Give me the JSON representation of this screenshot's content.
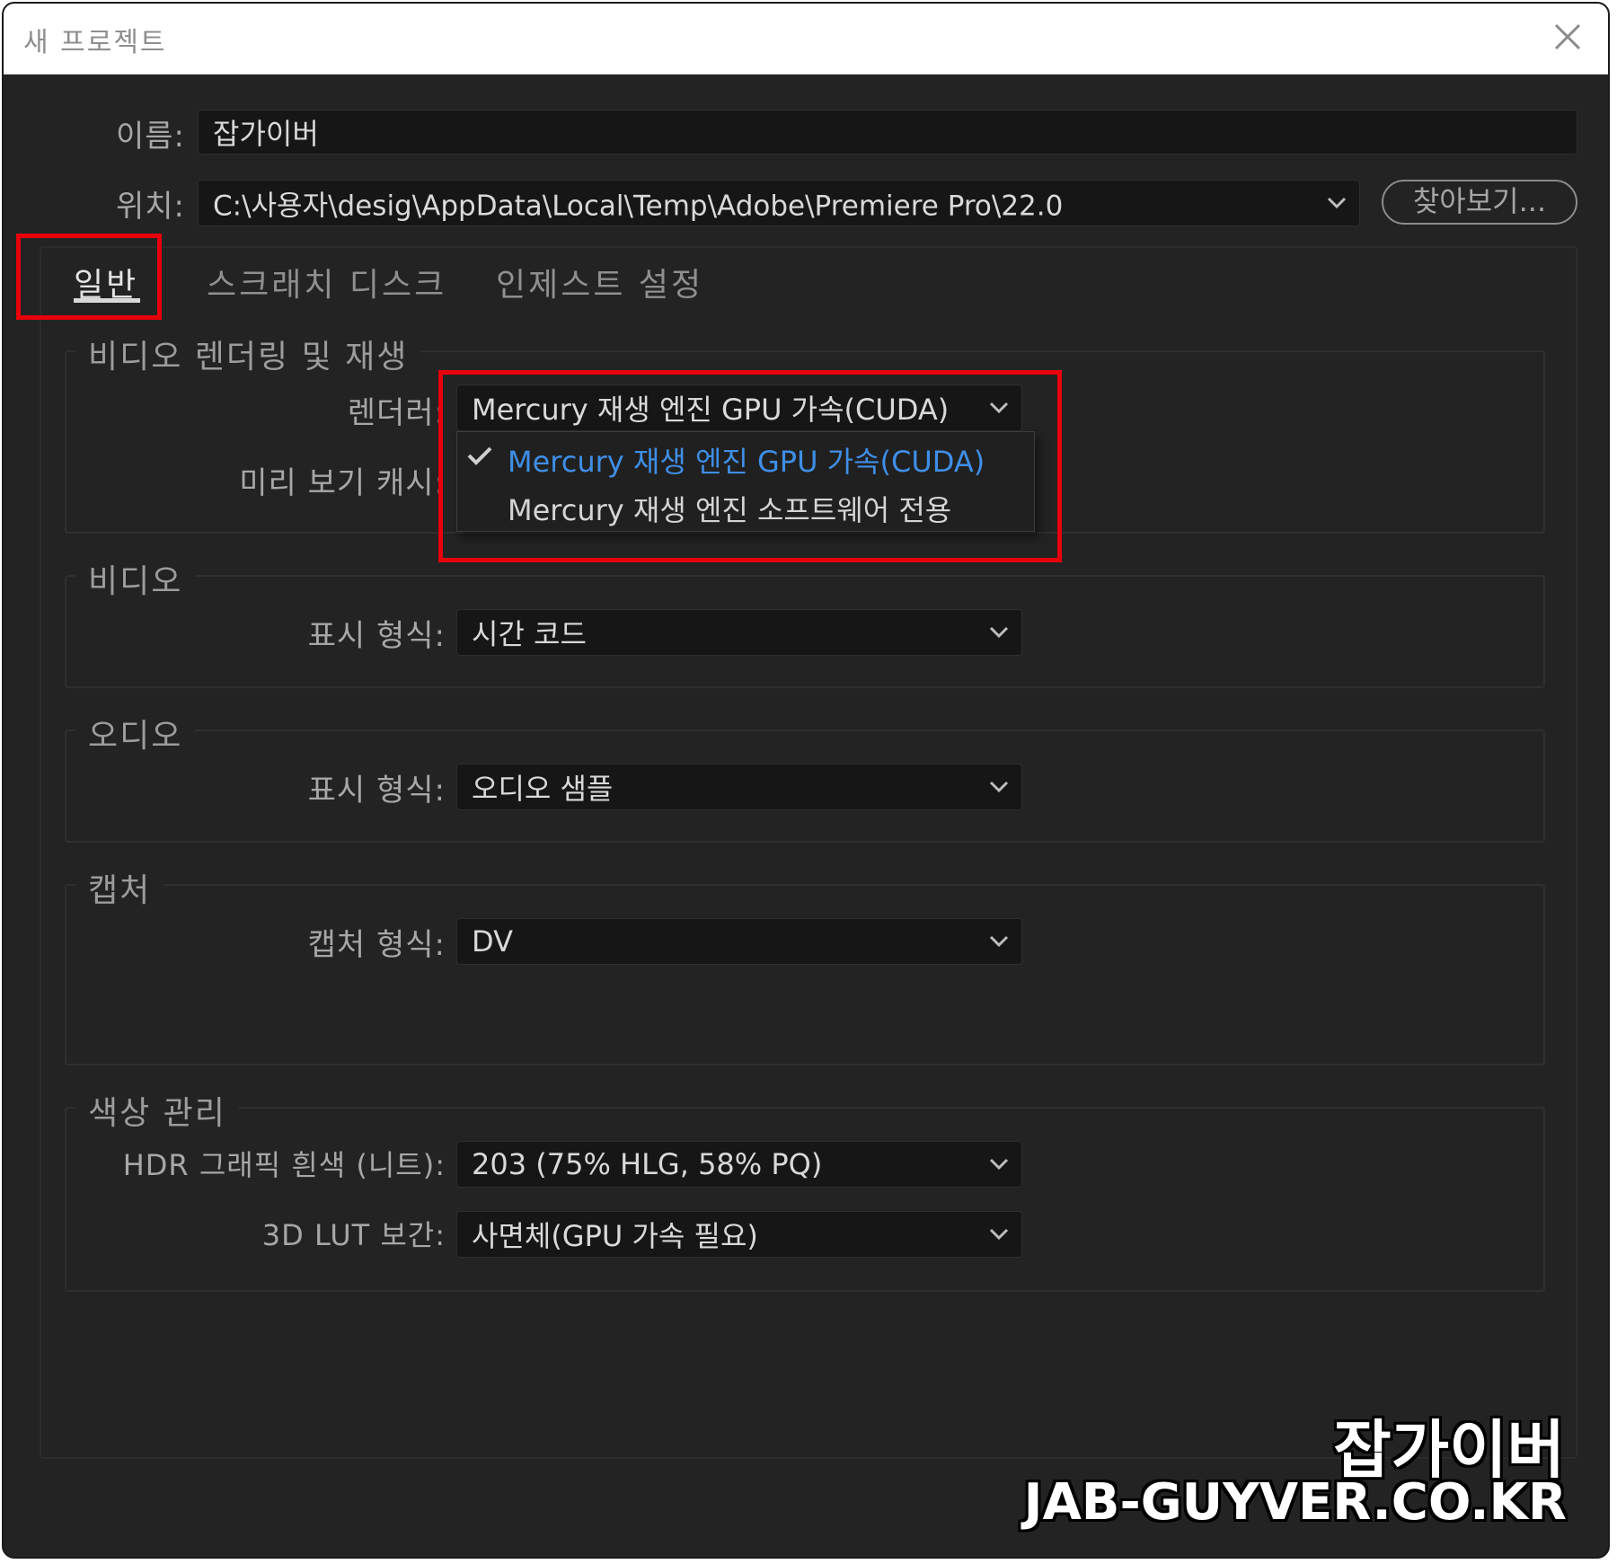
{
  "window": {
    "title": "새 프로젝트"
  },
  "form": {
    "name_label": "이름:",
    "name_value": "잡가이버",
    "location_label": "위치:",
    "location_value": "C:\\사용자\\desig\\AppData\\Local\\Temp\\Adobe\\Premiere Pro\\22.0",
    "browse_label": "찾아보기..."
  },
  "tabs": [
    {
      "label": "일반",
      "active": true
    },
    {
      "label": "스크래치 디스크",
      "active": false
    },
    {
      "label": "인제스트 설정",
      "active": false
    }
  ],
  "groups": {
    "render": {
      "title": "비디오 렌더링 및 재생",
      "renderer_label": "렌더러:",
      "renderer_value": "Mercury 재생 엔진 GPU 가속(CUDA)",
      "preview_cache_label": "미리 보기 캐시:",
      "menu_options": [
        {
          "label": "Mercury 재생 엔진 GPU 가속(CUDA)",
          "selected": true
        },
        {
          "label": "Mercury 재생 엔진 소프트웨어 전용",
          "selected": false
        }
      ]
    },
    "video": {
      "title": "비디오",
      "display_label": "표시 형식:",
      "display_value": "시간 코드"
    },
    "audio": {
      "title": "오디오",
      "display_label": "표시 형식:",
      "display_value": "오디오 샘플"
    },
    "capture": {
      "title": "캡처",
      "format_label": "캡처 형식:",
      "format_value": "DV"
    },
    "color": {
      "title": "색상 관리",
      "hdr_label": "HDR 그래픽 흰색 (니트):",
      "hdr_value": "203 (75% HLG, 58% PQ)",
      "lut_label": "3D LUT 보간:",
      "lut_value": "사면체(GPU 가속 필요)"
    }
  },
  "watermark": {
    "korean": "잡가이버",
    "domain": "JAB-GUYVER.CO.KR"
  },
  "colors": {
    "highlight": "#e8000b",
    "selected_item": "#3f8ee6",
    "background": "#232323"
  }
}
